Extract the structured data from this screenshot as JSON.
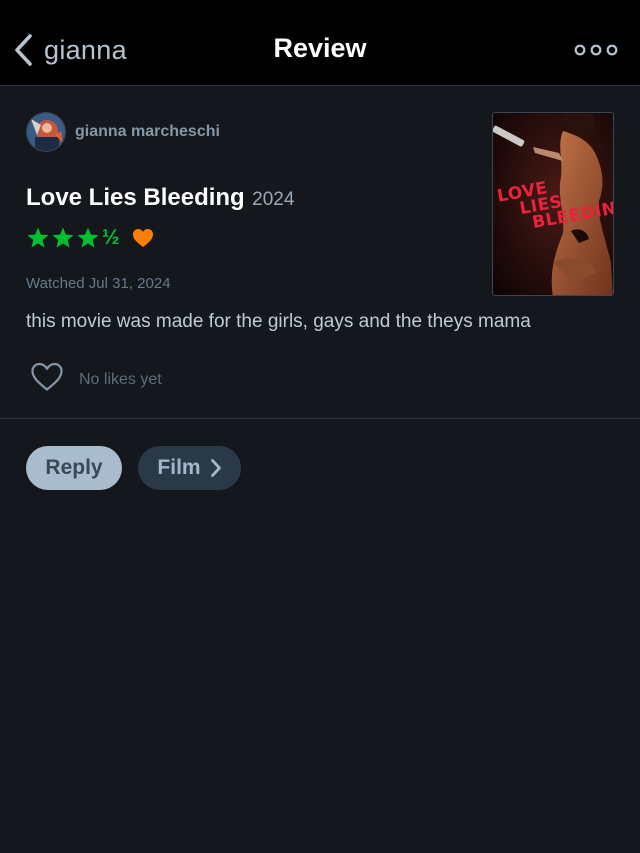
{
  "header": {
    "back_label": "gianna",
    "title": "Review",
    "more_icon": "ellipsis-icon"
  },
  "review": {
    "author": {
      "name": "gianna marcheschi",
      "avatar_icon": "avatar"
    },
    "film": {
      "title": "Love Lies Bleeding",
      "year": "2024"
    },
    "rating": {
      "stars": 3.5,
      "half_glyph": "½",
      "liked": true,
      "star_color": "#00c030",
      "heart_color": "#ff8000"
    },
    "watched": "Watched Jul 31, 2024",
    "text": "this movie was made for the girls, gays and the theys mama",
    "likes_label": "No likes yet",
    "poster": {
      "line1": "LOVE",
      "line2": "LIES",
      "line3": "BLEEDING",
      "accent": "#e8233b"
    }
  },
  "actions": {
    "reply_label": "Reply",
    "film_label": "Film"
  }
}
